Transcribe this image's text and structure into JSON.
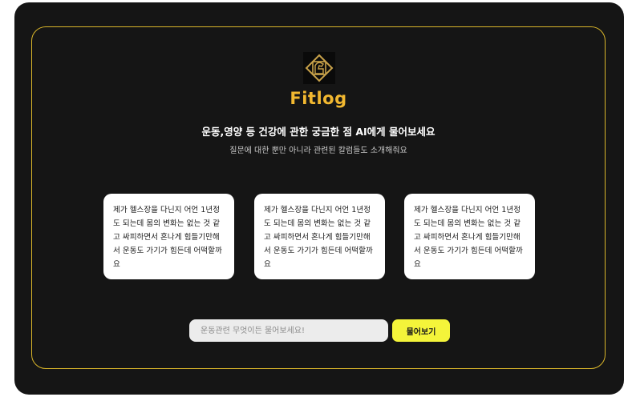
{
  "brand": {
    "name": "Fitlog",
    "logo_icon": "fitness-emblem-icon",
    "accent_color": "#f2b830",
    "border_color": "#d9b52a"
  },
  "hero": {
    "headline": "운동,영양 등 건강에 관한 궁금한 점 AI에게 물어보세요",
    "subline": "질문에 대한 뿐만 아니라 관련된 칼럼들도 소개해줘요"
  },
  "suggestions": [
    {
      "text": "제가 헬스장을 다닌지 어언 1년정도 되는데 몸의 변화는 없는 것 같고 싸피하면서 혼나게 힘들기만해서 운동도 가기가 힘든데 어떡할까요"
    },
    {
      "text": "제가 헬스장을 다닌지 어언 1년정도 되는데 몸의 변화는 없는 것 같고 싸피하면서 혼나게 힘들기만해서 운동도 가기가 힘든데 어떡할까요"
    },
    {
      "text": "제가 헬스장을 다닌지 어언 1년정도 되는데 몸의 변화는 없는 것 같고 싸피하면서 혼나게 힘들기만해서 운동도 가기가 힘든데 어떡할까요"
    }
  ],
  "search": {
    "value": "",
    "placeholder": "운동관련 무엇이든 물어보세요!",
    "button_label": "물어보기",
    "button_color": "#f4f43a"
  }
}
